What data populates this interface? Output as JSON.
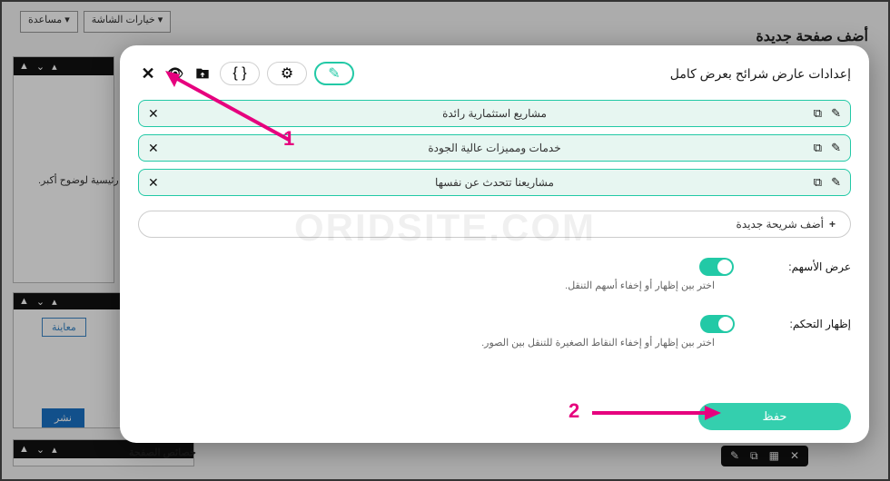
{
  "bg": {
    "help": "مساعدة ▾",
    "screen_options": "خيارات الشاشة ▾",
    "page_title": "أضف صفحة جديدة",
    "caption": "رئيسية لوضوح أكبر.",
    "preview": "معاينة",
    "publish": "نشر",
    "props": "خصائص الصفحة"
  },
  "modal": {
    "title": "إعدادات عارض شرائح بعرض كامل",
    "slides": [
      {
        "text": "مشاريع استثمارية رائدة"
      },
      {
        "text": "خدمات ومميزات عالية الجودة"
      },
      {
        "text": "مشاريعنا تتحدث عن نفسها"
      }
    ],
    "add_slide": "أضف شريحة جديدة",
    "settings": {
      "arrows": {
        "label": "عرض الأسهم:",
        "hint": "اختر بين إظهار أو إخفاء أسهم التنقل.",
        "on": true
      },
      "dots": {
        "label": "إظهار التحكم:",
        "hint": "اختر بين إظهار أو إخفاء النقاط الصغيرة للتنقل بين الصور.",
        "on": true
      }
    },
    "save": "حفظ"
  },
  "watermark": "ORIDSITE.COM",
  "annotations": {
    "one": "1",
    "two": "2"
  }
}
